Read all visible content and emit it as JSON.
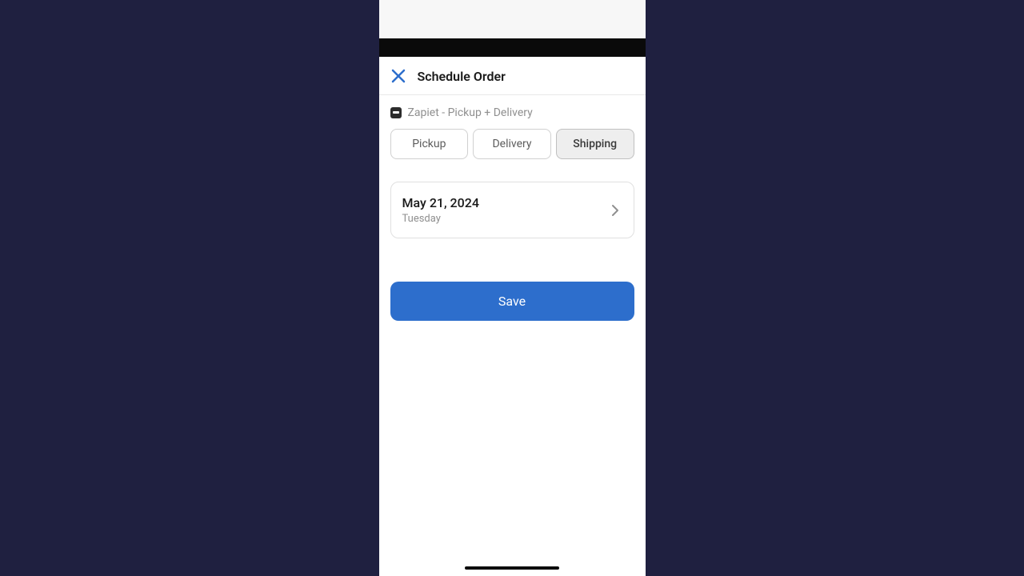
{
  "modal": {
    "title": "Schedule Order",
    "app_name": "Zapiet - Pickup + Delivery"
  },
  "segments": {
    "pickup": "Pickup",
    "delivery": "Delivery",
    "shipping": "Shipping"
  },
  "date": {
    "value": "May 21, 2024",
    "day": "Tuesday"
  },
  "actions": {
    "save": "Save"
  }
}
